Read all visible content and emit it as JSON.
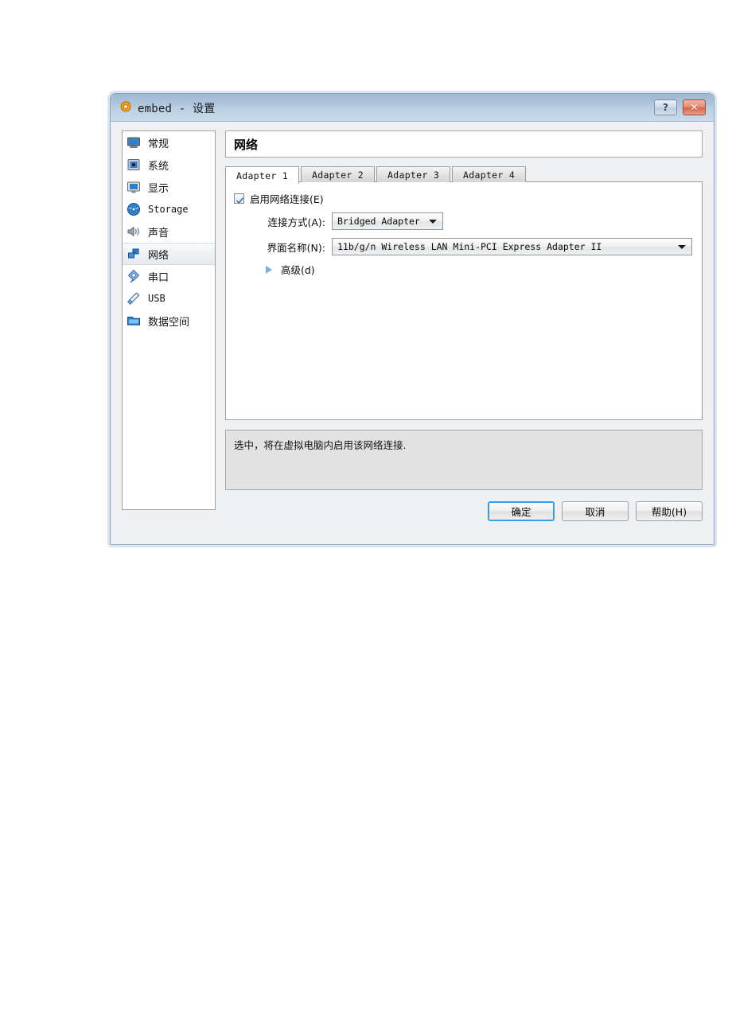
{
  "window": {
    "title": "embed - 设置",
    "app_icon": "gear-icon",
    "help_button": "?",
    "close_button": "✕"
  },
  "sidebar": {
    "items": [
      {
        "label": "常规",
        "icon": "monitor-icon",
        "ascii": false,
        "selected": false
      },
      {
        "label": "系统",
        "icon": "chip-icon",
        "ascii": false,
        "selected": false
      },
      {
        "label": "显示",
        "icon": "display-icon",
        "ascii": false,
        "selected": false
      },
      {
        "label": "Storage",
        "icon": "disc-icon",
        "ascii": true,
        "selected": false
      },
      {
        "label": "声音",
        "icon": "speaker-icon",
        "ascii": false,
        "selected": false
      },
      {
        "label": "网络",
        "icon": "network-icon",
        "ascii": false,
        "selected": true
      },
      {
        "label": "串口",
        "icon": "serial-port-icon",
        "ascii": false,
        "selected": false
      },
      {
        "label": "USB",
        "icon": "usb-icon",
        "ascii": true,
        "selected": false
      },
      {
        "label": "数据空间",
        "icon": "folder-icon",
        "ascii": false,
        "selected": false
      }
    ]
  },
  "page": {
    "header_title": "网络",
    "tabs": [
      {
        "label": "Adapter 1",
        "active": true
      },
      {
        "label": "Adapter 2",
        "active": false
      },
      {
        "label": "Adapter 3",
        "active": false
      },
      {
        "label": "Adapter 4",
        "active": false
      }
    ],
    "enable_checkbox": {
      "label": "启用网络连接(E)",
      "checked": true
    },
    "attachment": {
      "label": "连接方式(A):",
      "value": "Bridged Adapter"
    },
    "interface_name": {
      "label": "界面名称(N):",
      "value": "11b/g/n  Wireless LAN Mini-PCI Express Adapter II"
    },
    "advanced": {
      "label": "高级(d)",
      "expanded": false
    }
  },
  "hint": {
    "text": "选中，将在虚拟电脑内启用该网络连接."
  },
  "buttons": {
    "ok": "确定",
    "cancel": "取消",
    "help": "帮助(H)"
  },
  "colors": {
    "titlebar_top": "#9fb7d1",
    "titlebar_bottom": "#c8d9ea",
    "dialog_bg": "#eff0f1",
    "close_button": "#d4664c",
    "focus_blue": "#3d9ce0",
    "advanced_arrow": "#7aade0",
    "icon_blue": "#2f7fd0",
    "gear_orange": "#f0a21e"
  }
}
